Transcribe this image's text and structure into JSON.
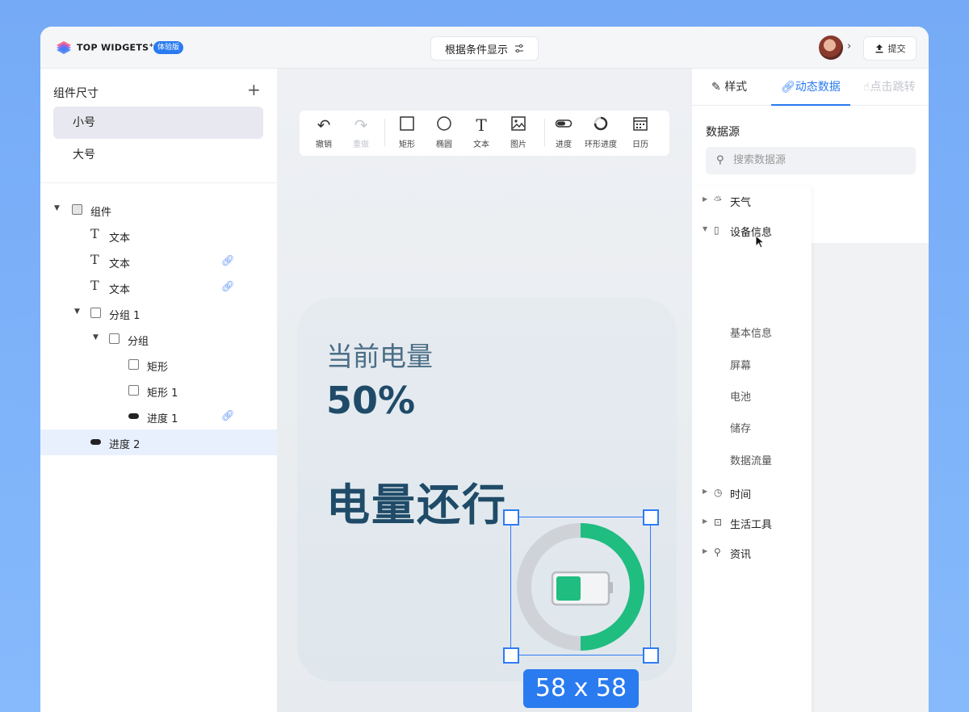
{
  "app": {
    "brand": "TOP WIDGETS",
    "brand_sup": "+",
    "badge": "体验版",
    "condition_button": "根据条件显示",
    "submit_button": "提交"
  },
  "left_panel": {
    "size_title": "组件尺寸",
    "sizes": [
      {
        "label": "小号",
        "active": true
      },
      {
        "label": "大号",
        "active": false
      }
    ],
    "tree": [
      {
        "label": "组件",
        "icon": "group-icon",
        "expanded": true,
        "linked": false
      },
      {
        "label": "文本",
        "icon": "text-icon",
        "linked": false
      },
      {
        "label": "文本",
        "icon": "text-icon",
        "linked": true
      },
      {
        "label": "文本",
        "icon": "text-icon",
        "linked": true
      },
      {
        "label": "分组 1",
        "icon": "group-box-icon",
        "expanded": true,
        "linked": false
      },
      {
        "label": "分组",
        "icon": "group-box-icon",
        "expanded": true,
        "linked": false
      },
      {
        "label": "矩形",
        "icon": "rectangle-icon",
        "linked": false
      },
      {
        "label": "矩形 1",
        "icon": "rectangle-icon",
        "linked": false
      },
      {
        "label": "进度 1",
        "icon": "progress-icon",
        "linked": true
      },
      {
        "label": "进度 2",
        "icon": "progress-icon",
        "linked": false,
        "selected": true
      }
    ]
  },
  "toolbar": {
    "tools": [
      {
        "label": "撤销",
        "icon": "undo-icon",
        "enabled": true
      },
      {
        "label": "重做",
        "icon": "redo-icon",
        "enabled": false
      },
      {
        "label": "矩形",
        "icon": "rectangle-icon",
        "enabled": true
      },
      {
        "label": "椭圆",
        "icon": "ellipse-icon",
        "enabled": true
      },
      {
        "label": "文本",
        "icon": "text-icon",
        "enabled": true
      },
      {
        "label": "图片",
        "icon": "image-icon",
        "enabled": true
      },
      {
        "label": "进度",
        "icon": "progress-icon",
        "enabled": true
      },
      {
        "label": "环形进度",
        "icon": "ring-progress-icon",
        "enabled": true
      },
      {
        "label": "日历",
        "icon": "calendar-icon",
        "enabled": true
      }
    ]
  },
  "widget": {
    "subtitle": "当前电量",
    "percent": "50%",
    "main_text": "电量还行",
    "ring_progress": 0.5,
    "size_label": "58 x 58",
    "colors": {
      "ring": "#1fbd80",
      "ring_track": "#cfd3d8",
      "text_dark": "#1f4b68",
      "text_light": "#4b6e86"
    }
  },
  "right_panel": {
    "tabs": [
      {
        "label": "样式",
        "icon": "brush-icon",
        "state": "normal"
      },
      {
        "label": "动态数据",
        "icon": "link-icon",
        "state": "active"
      },
      {
        "label": "点击跳转",
        "icon": "hand-pointer-icon",
        "state": "disabled"
      }
    ],
    "datasource_title": "数据源",
    "search_placeholder": "搜索数据源",
    "categories": [
      {
        "label": "天气",
        "icon": "weather-icon",
        "expanded": false
      },
      {
        "label": "设备信息",
        "icon": "device-icon",
        "expanded": true,
        "children": [
          "基本信息",
          "屏幕",
          "电池",
          "储存",
          "数据流量"
        ]
      },
      {
        "label": "时间",
        "icon": "clock-icon",
        "expanded": false
      },
      {
        "label": "生活工具",
        "icon": "toolbox-icon",
        "expanded": false
      },
      {
        "label": "资讯",
        "icon": "location-pin-icon",
        "expanded": false
      }
    ]
  },
  "colors": {
    "accent": "#2a7bf0",
    "background": "#75aaf6"
  }
}
